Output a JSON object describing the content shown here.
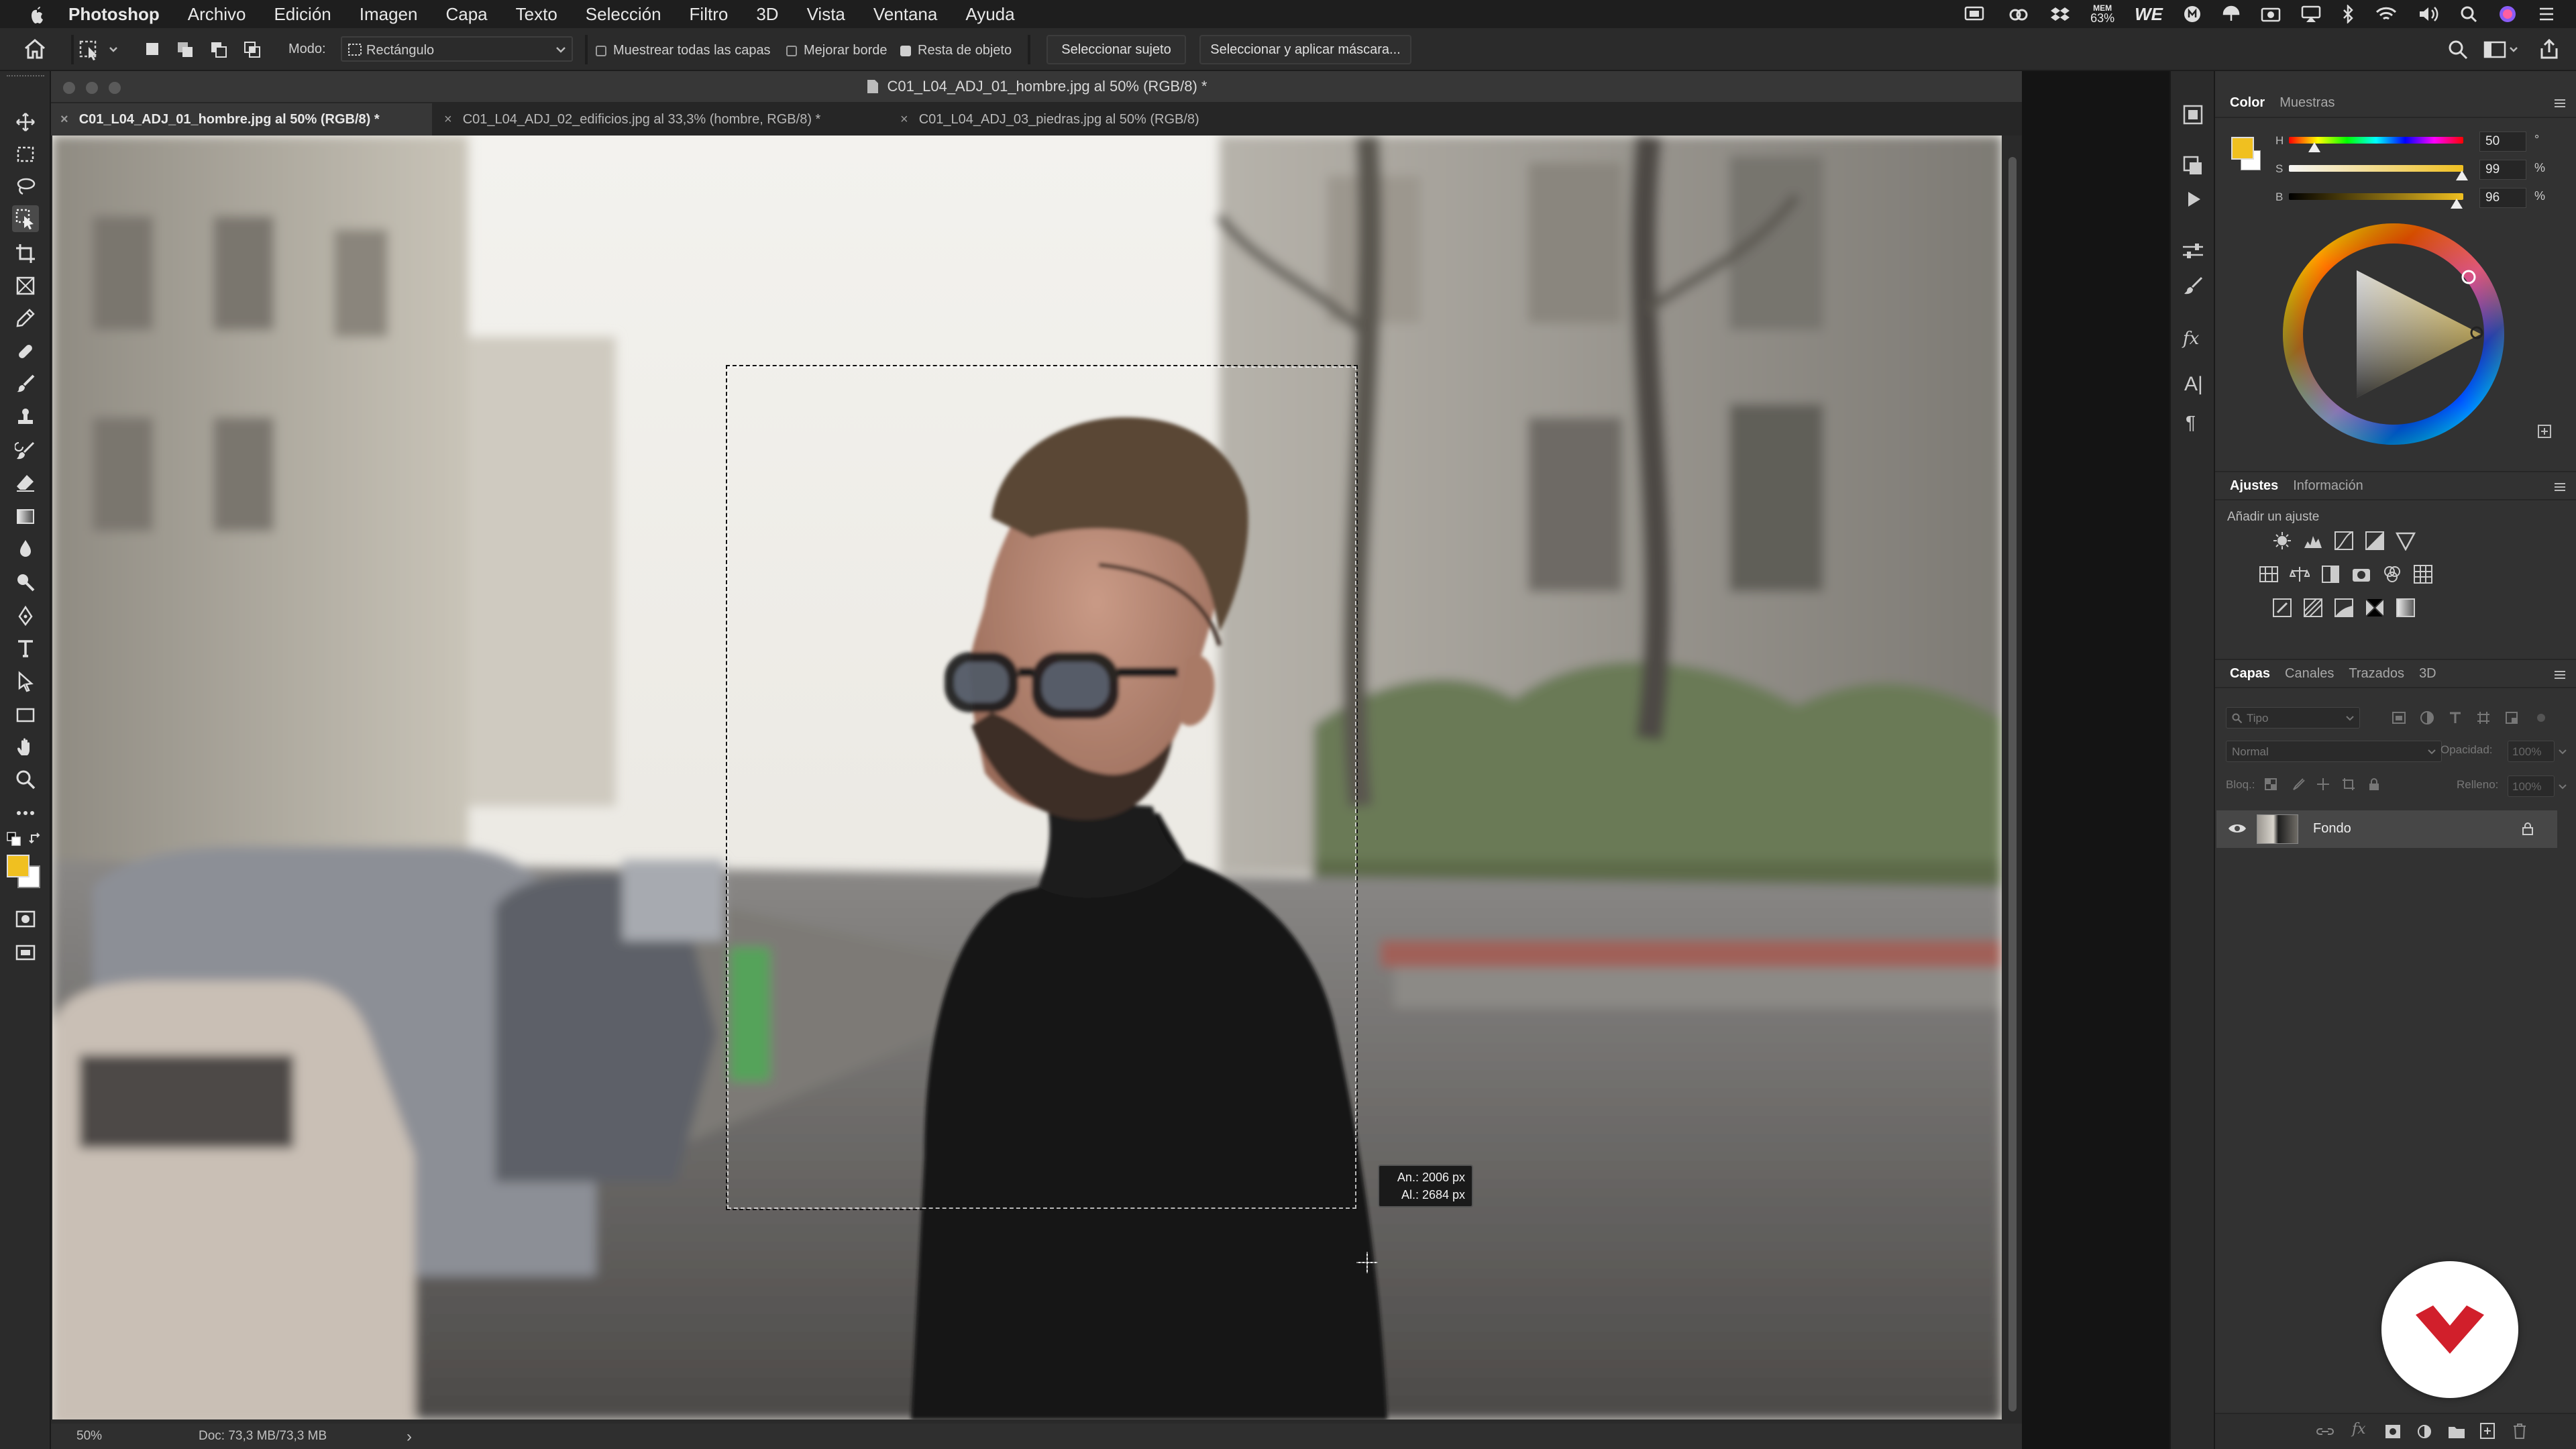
{
  "menubar": {
    "app_name": "Photoshop",
    "items": [
      "Archivo",
      "Edición",
      "Imagen",
      "Capa",
      "Texto",
      "Selección",
      "Filtro",
      "3D",
      "Vista",
      "Ventana",
      "Ayuda"
    ],
    "mem_label": "MEM",
    "mem_value": "63%"
  },
  "options_bar": {
    "mode_label": "Modo:",
    "mode_value": "Rectángulo",
    "sample_all_layers": "Muestrear todas las capas",
    "sample_all_layers_checked": false,
    "enhance_edge": "Mejorar borde",
    "enhance_edge_checked": false,
    "object_subtract": "Resta de objeto",
    "object_subtract_checked": true,
    "select_subject": "Seleccionar sujeto",
    "select_and_mask": "Seleccionar y aplicar máscara..."
  },
  "document": {
    "window_title": "C01_L04_ADJ_01_hombre.jpg al 50% (RGB/8) *",
    "tabs": [
      {
        "label": "C01_L04_ADJ_01_hombre.jpg al 50% (RGB/8) *",
        "active": true
      },
      {
        "label": "C01_L04_ADJ_02_edificios.jpg al 33,3% (hombre, RGB/8) *",
        "active": false
      },
      {
        "label": "C01_L04_ADJ_03_piedras.jpg al 50% (RGB/8)",
        "active": false
      }
    ],
    "tooltip": {
      "width": "An.: 2006 px",
      "height": "Al.: 2684 px"
    },
    "status_zoom": "50%",
    "status_doc": "Doc: 73,3 MB/73,3 MB",
    "status_arrow": "›"
  },
  "color_panel": {
    "tabs": [
      "Color",
      "Muestras"
    ],
    "foreground": "#f0c020",
    "background": "#ffffff",
    "hsb": [
      {
        "label": "H",
        "value": "50",
        "unit": "°",
        "fraction": 0.14
      },
      {
        "label": "S",
        "value": "99",
        "unit": "%",
        "fraction": 0.99
      },
      {
        "label": "B",
        "value": "96",
        "unit": "%",
        "fraction": 0.96
      }
    ]
  },
  "adjustments_panel": {
    "tabs": [
      "Ajustes",
      "Información"
    ],
    "add_label": "Añadir un ajuste"
  },
  "layers_panel": {
    "tabs": [
      "Capas",
      "Canales",
      "Trazados",
      "3D"
    ],
    "filter_placeholder": "Tipo",
    "blend_mode": "Normal",
    "opacity_label": "Opacidad:",
    "opacity_value": "100%",
    "lock_label": "Bloq.:",
    "fill_label": "Relleno:",
    "fill_value": "100%",
    "layers": [
      {
        "name": "Fondo",
        "visible": true,
        "locked": true
      }
    ]
  },
  "colors": {
    "accent_yellow": "#f0c020",
    "brand_red": "#d11f2b"
  }
}
